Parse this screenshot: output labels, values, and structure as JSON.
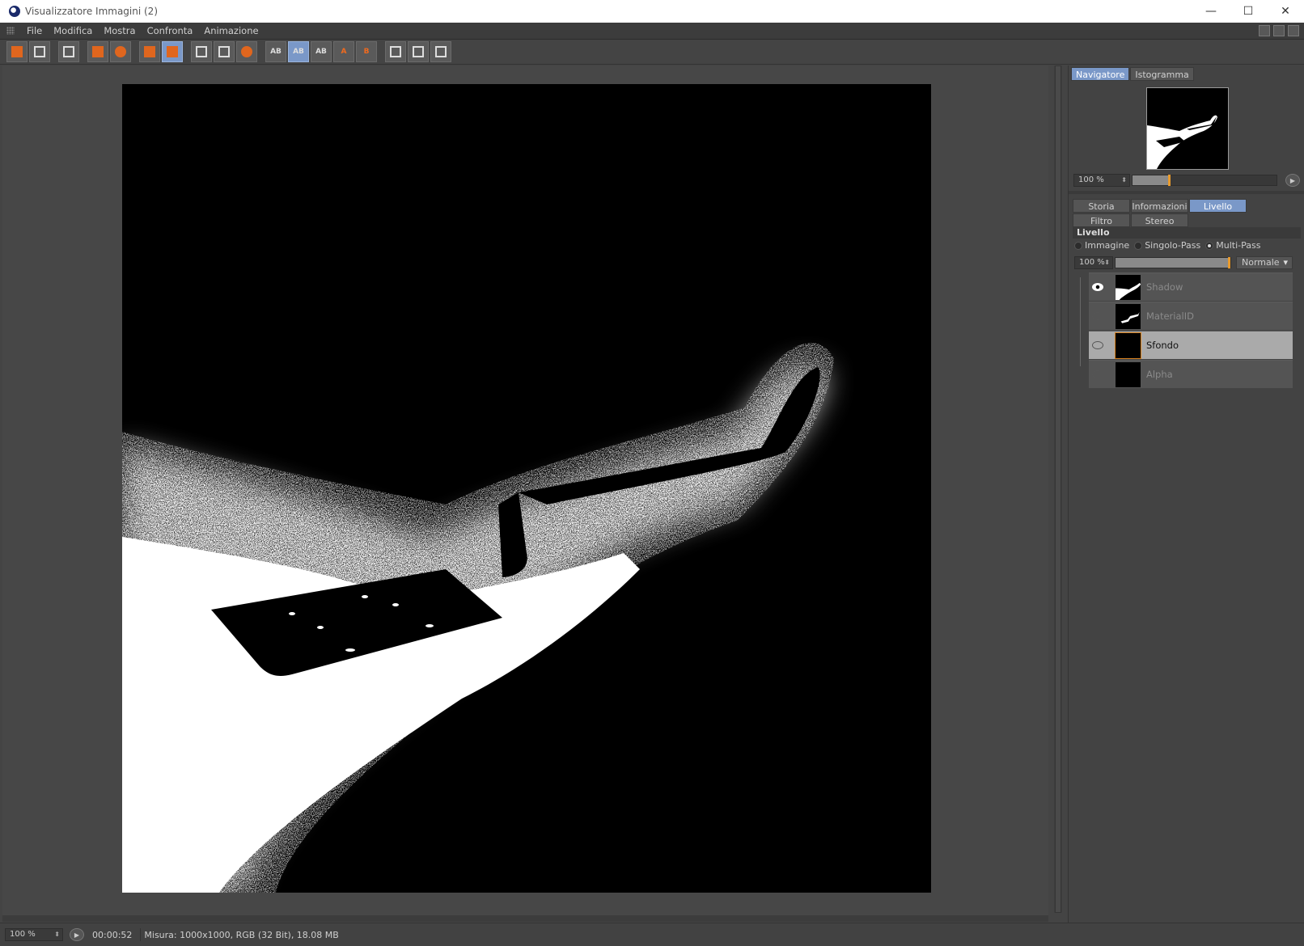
{
  "window": {
    "title": "Visualizzatore Immagini (2)",
    "controls": [
      "—",
      "☐",
      "✕"
    ]
  },
  "menu": {
    "items": [
      "File",
      "Modifica",
      "Mostra",
      "Confronta",
      "Animazione"
    ]
  },
  "toolbar": {
    "groups": [
      [
        "open-icon",
        "save-icon"
      ],
      [
        "grid-icon"
      ],
      [
        "fit-icon",
        "snapshot-icon"
      ],
      [
        "copy-icon",
        "layers-icon"
      ],
      [
        "region-icon",
        "region-view-icon",
        "render-view-icon"
      ],
      [
        "compare-ab-icon",
        "compare-ab-active-icon",
        "compare-ab-swap-icon",
        "set-a-icon",
        "set-b-icon"
      ],
      [
        "split-h-icon",
        "split-v-icon",
        "split-grid-icon"
      ]
    ],
    "glyph_text": {
      "a": "A",
      "b": "B",
      "ab": "AB"
    }
  },
  "navigator": {
    "tabs": [
      "Navigatore",
      "Istogramma"
    ],
    "active_tab": "Navigatore",
    "zoom_value": "100 %",
    "zoom_level": 0.25
  },
  "panel_tabs": {
    "row1": [
      "Storia",
      "Informazioni",
      "Livello"
    ],
    "row2": [
      "Filtro",
      "Stereo"
    ],
    "active": "Livello"
  },
  "layer_section": {
    "title": "Livello",
    "modes": [
      "Immagine",
      "Singolo-Pass",
      "Multi-Pass"
    ],
    "selected_mode": "Multi-Pass",
    "opacity_value": "100 %",
    "opacity_level": 1.0,
    "blend_mode": "Normale"
  },
  "layers": [
    {
      "name": "Shadow",
      "visible": true,
      "selected": false
    },
    {
      "name": "MaterialID",
      "visible": false,
      "selected": false
    },
    {
      "name": "Sfondo",
      "visible": false,
      "selected": true
    },
    {
      "name": "Alpha",
      "visible": false,
      "selected": false
    }
  ],
  "status": {
    "zoom_value": "100 %",
    "time": "00:00:52",
    "info": "Misura: 1000x1000, RGB (32 Bit), 18.08 MB"
  },
  "colors": {
    "accent": "#7a98c8",
    "highlight": "#e89a2c",
    "panel_bg": "#434343",
    "viewport_bg": "#474747"
  }
}
